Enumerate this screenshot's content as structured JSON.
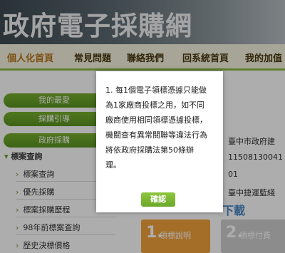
{
  "header": {
    "title": "政府電子採購網"
  },
  "nav": {
    "items": [
      "個人化首頁",
      "常見問題",
      "聯絡我們",
      "回系統首頁",
      "我的加值"
    ],
    "active_index": 0
  },
  "sidebar": {
    "pills": [
      "我的最愛",
      "採購引導",
      "政府採購"
    ],
    "section_label": "標案查詢",
    "links": [
      "標案查詢",
      "優先採購",
      "標案採購歷程",
      "98年前標案查詢",
      "歷史決標價格"
    ]
  },
  "content": {
    "rows": [
      "臺中市政府建",
      "11508130041",
      "01",
      "臺中捷運藍綫"
    ],
    "download_label": "下載",
    "steps": [
      {
        "num": "1.",
        "label": "領標說明"
      },
      {
        "num": "2.",
        "label": "領標付費"
      }
    ]
  },
  "modal": {
    "lines": [
      "1. 每1個電子領標憑據只能做",
      "為1家廠商投標之用，如不同",
      "廠商使用相同領標憑據投標，",
      "機關查有異常關聯等違法行為",
      "將依政府採購法第50條辦",
      "理。"
    ],
    "confirm_label": "確認"
  },
  "colors": {
    "accent_green": "#6ba82a",
    "step_orange": "#f3a23c",
    "nav_bg": "#f7f3df"
  }
}
